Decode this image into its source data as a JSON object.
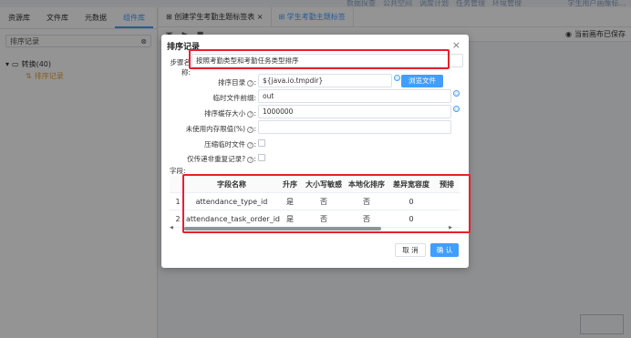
{
  "topmenu": {
    "items": [
      "数据探查",
      "公共空间",
      "调度计划",
      "任务管理",
      "环境管理"
    ],
    "user": "学生用户画像标..."
  },
  "left": {
    "tabs": [
      "资源库",
      "文件库",
      "元数据",
      "组件库"
    ],
    "search_value": "排序记录",
    "tree": {
      "parent": "转换(40)",
      "child": "排序记录"
    }
  },
  "work": {
    "tabs": [
      "创建学生考勤主题标签表",
      "学生考勤主题标签"
    ],
    "autosave": "当前画布已保存"
  },
  "dialog": {
    "title": "排序记录",
    "step_label": "步骤名称:",
    "step_value": "按照考勤类型和考勤任务类型排序",
    "dir_label": "排序目录",
    "dir_value": "${java.io.tmpdir}",
    "browse": "浏览文件",
    "prefix_label": "临时文件前缀",
    "prefix_value": "out",
    "cache_label": "排序缓存大小",
    "cache_value": "1000000",
    "mem_label": "未使用内存限值(%)",
    "mem_value": "",
    "compress_label": "压缩临时文件",
    "unique_label": "仅传递非重复记录?",
    "fields_label": "字段:",
    "table": {
      "headers": [
        "字段名称",
        "升序",
        "大小写敏感",
        "本地化排序",
        "差异宽容度",
        "预排"
      ],
      "rows": [
        {
          "idx": "1",
          "name": "attendance_type_id",
          "asc": "是",
          "case": "否",
          "local": "否",
          "tol": "0"
        },
        {
          "idx": "2",
          "name": "attendance_task_order_id",
          "asc": "是",
          "case": "否",
          "local": "否",
          "tol": "0"
        }
      ]
    },
    "cancel": "取 消",
    "ok": "确 认"
  },
  "colors": {
    "primary": "#409eff",
    "highlight": "#e8202a"
  }
}
